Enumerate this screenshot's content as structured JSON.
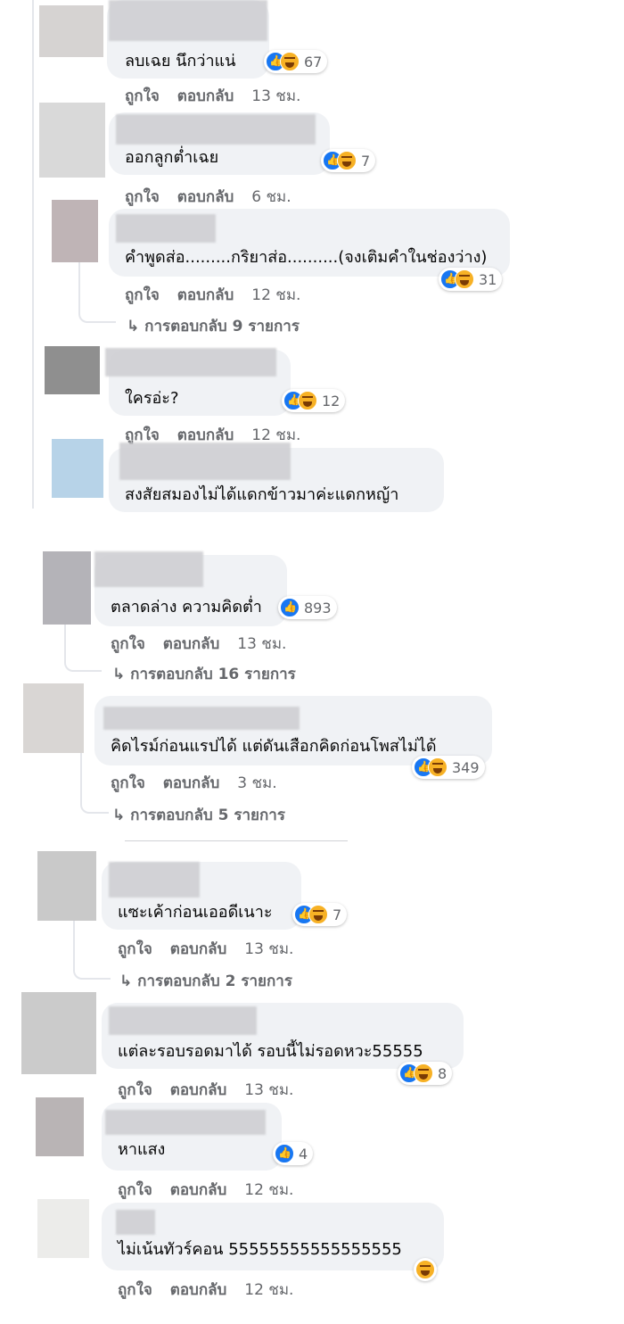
{
  "actions": {
    "like": "ถูกใจ",
    "reply": "ตอบกลับ"
  },
  "comments": [
    {
      "text": "ลบเฉย นึกว่าแน่",
      "time": "13 ชม.",
      "count": "67"
    },
    {
      "text": "ออกลูกต่ำเฉย",
      "time": "6 ชม.",
      "count": "7"
    },
    {
      "text": "คำพูดส่อ.........กริยาส่อ..........(จงเติมคำในช่องว่าง)",
      "time": "12 ชม.",
      "count": "31",
      "replies": "การตอบกลับ 9 รายการ"
    },
    {
      "text": "ใครอ่ะ?",
      "time": "12 ชม.",
      "count": "12"
    },
    {
      "text": "สงสัยสมองไม่ได้แดกข้าวมาค่ะแดกหญ้า"
    },
    {
      "text": "ตลาดล่าง ความคิดต่ำ",
      "time": "13 ชม.",
      "count": "893",
      "replies": "การตอบกลับ 16 รายการ"
    },
    {
      "text": "คิดไรม์ก่อนแรปได้ แต่ดันเสือกคิดก่อนโพสไม่ได้",
      "time": "3 ชม.",
      "count": "349",
      "replies": "การตอบกลับ 5 รายการ"
    },
    {
      "text": "แซะเค้าก่อนเออดีเนาะ",
      "time": "13 ชม.",
      "count": "7",
      "replies": "การตอบกลับ 2 รายการ"
    },
    {
      "text": "แต่ละรอบรอดมาได้ รอบนี้ไม่รอดหวะ55555",
      "time": "13 ชม.",
      "count": "8"
    },
    {
      "text": "หาแสง",
      "time": "12 ชม.",
      "count": "4"
    },
    {
      "text": "ไม่เน้นทัวร์คอน 55555555555555555",
      "time": "12 ชม."
    }
  ],
  "icons": {
    "like": "like-reaction-icon",
    "haha": "haha-reaction-icon",
    "reply_arrow": "reply-arrow-icon"
  }
}
